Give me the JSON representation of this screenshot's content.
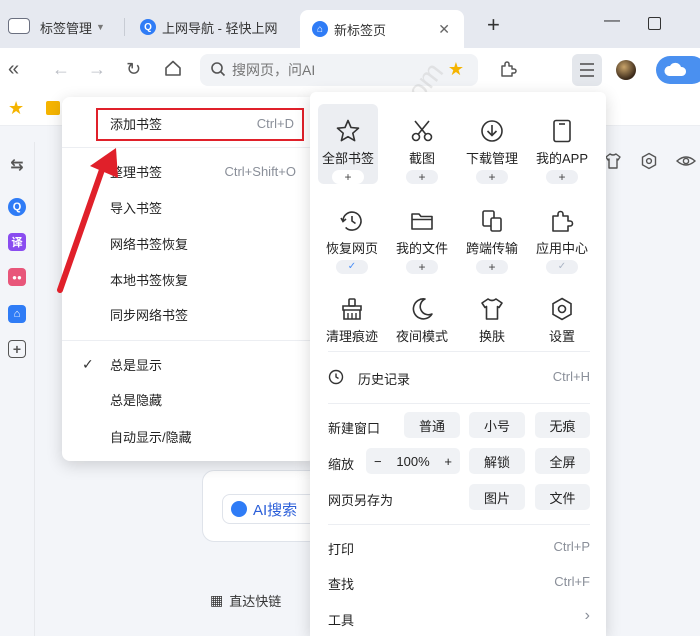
{
  "tabs": [
    {
      "label": "标签管理",
      "icon": "tab-manager-icon"
    },
    {
      "label": "上网导航 - 轻快上网",
      "icon": "q-logo-icon"
    },
    {
      "label": "新标签页",
      "icon": "home-logo-icon"
    }
  ],
  "address_bar": {
    "placeholder": "搜网页，问AI"
  },
  "bookmark_menu": {
    "items": [
      {
        "label": "添加书签",
        "shortcut": "Ctrl+D"
      },
      {
        "label": "整理书签",
        "shortcut": "Ctrl+Shift+O"
      },
      {
        "label": "导入书签",
        "shortcut": ""
      },
      {
        "label": "网络书签恢复",
        "shortcut": ""
      },
      {
        "label": "本地书签恢复",
        "shortcut": ""
      },
      {
        "label": "同步网络书签",
        "shortcut": ""
      }
    ],
    "display_options": [
      {
        "label": "总是显示",
        "checked": true
      },
      {
        "label": "总是隐藏",
        "checked": false
      },
      {
        "label": "自动显示/隐藏",
        "checked": false
      }
    ]
  },
  "main_menu": {
    "tiles": [
      {
        "label": "全部书签",
        "icon": "star-icon",
        "badge": "+"
      },
      {
        "label": "截图",
        "icon": "scissors-icon",
        "badge": "+"
      },
      {
        "label": "下载管理",
        "icon": "download-icon",
        "badge": "+"
      },
      {
        "label": "我的APP",
        "icon": "app-icon",
        "badge": "+"
      },
      {
        "label": "恢复网页",
        "icon": "history-icon",
        "badge": "check"
      },
      {
        "label": "我的文件",
        "icon": "folder-icon",
        "badge": "+"
      },
      {
        "label": "跨端传输",
        "icon": "transfer-icon",
        "badge": "+"
      },
      {
        "label": "应用中心",
        "icon": "puzzle-icon",
        "badge": "check"
      },
      {
        "label": "清理痕迹",
        "icon": "broom-icon",
        "badge": ""
      },
      {
        "label": "夜间模式",
        "icon": "moon-icon",
        "badge": ""
      },
      {
        "label": "换肤",
        "icon": "shirt-icon",
        "badge": ""
      },
      {
        "label": "设置",
        "icon": "settings-icon",
        "badge": ""
      }
    ],
    "history": {
      "label": "历史记录",
      "shortcut": "Ctrl+H"
    },
    "new_window": {
      "label": "新建窗口",
      "options": [
        "普通",
        "小号",
        "无痕"
      ]
    },
    "zoom": {
      "label": "缩放",
      "minus": "−",
      "value": "100%",
      "plus": "+",
      "unlock": "解锁",
      "fullscreen": "全屏"
    },
    "save_as": {
      "label": "网页另存为",
      "options": [
        "图片",
        "文件"
      ]
    },
    "print": {
      "label": "打印",
      "shortcut": "Ctrl+P"
    },
    "find": {
      "label": "查找",
      "shortcut": "Ctrl+F"
    },
    "tools": {
      "label": "工具",
      "chevron": "›"
    }
  },
  "page": {
    "ai_search_label": "AI搜索",
    "quick_links_label": "直达快链"
  },
  "watermark": "天极下载站 mydown.yesky.com",
  "colors": {
    "accent": "#2f7cf6",
    "highlight": "#e0202a"
  }
}
